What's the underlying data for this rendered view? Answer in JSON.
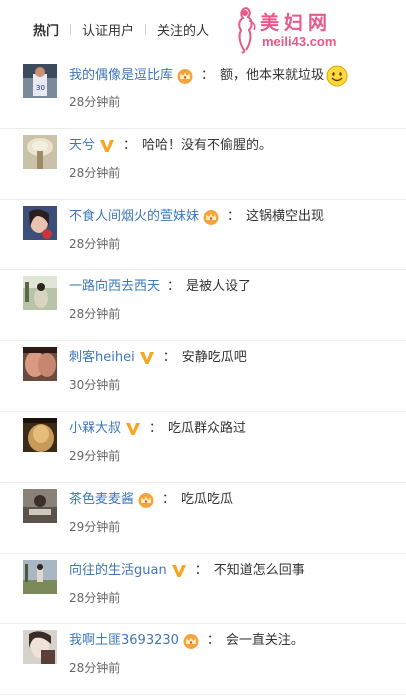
{
  "tabs": [
    {
      "label": "热门",
      "active": true
    },
    {
      "label": "认证用户",
      "active": false
    },
    {
      "label": "关注的人",
      "active": false
    }
  ],
  "watermark": {
    "title": "美妇网",
    "url": "meili43.com"
  },
  "comments": [
    {
      "user": "我的偶像是逗比库",
      "badge": "crown",
      "text": "额，他本来就垃圾",
      "emoji": "smile-emoji",
      "time": "28分钟前"
    },
    {
      "user": "天兮",
      "badge": "vip-v",
      "text": "哈哈！没有不偷腥的。",
      "emoji": "",
      "time": "28分钟前"
    },
    {
      "user": "不食人间烟火的萱妹妹",
      "badge": "crown",
      "text": "这锅横空出现",
      "emoji": "",
      "time": "28分钟前"
    },
    {
      "user": "一路向西去西天",
      "badge": "",
      "text": "是被人设了",
      "emoji": "",
      "time": "28分钟前"
    },
    {
      "user": "刺客heihei",
      "badge": "vip-v",
      "text": "安静吃瓜吧",
      "emoji": "",
      "time": "30分钟前"
    },
    {
      "user": "小槑大叔",
      "badge": "vip-v",
      "text": "吃瓜群众路过",
      "emoji": "",
      "time": "29分钟前"
    },
    {
      "user": "茶色麦麦酱",
      "badge": "crown",
      "text": "吃瓜吃瓜",
      "emoji": "",
      "time": "29分钟前"
    },
    {
      "user": "向往的生活guan",
      "badge": "vip-v",
      "text": "不知道怎么回事",
      "emoji": "",
      "time": "28分钟前"
    },
    {
      "user": "我啊土匪3693230",
      "badge": "crown",
      "text": "会一直关注。",
      "emoji": "",
      "time": "28分钟前"
    }
  ]
}
